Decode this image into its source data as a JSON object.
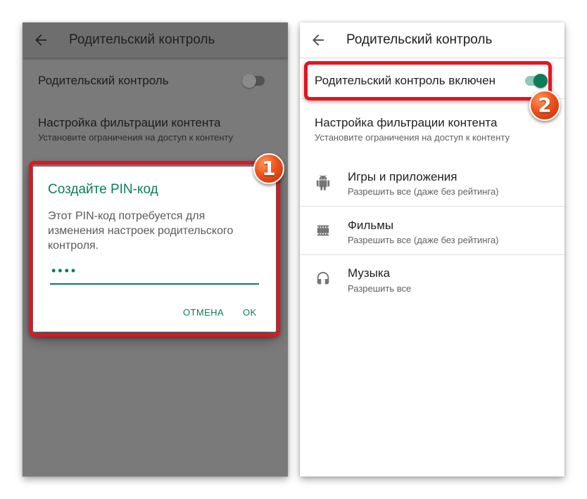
{
  "left_screen": {
    "title": "Родительский контроль",
    "toggle_label": "Родительский контроль",
    "toggle_state": "off",
    "filter_title": "Настройка фильтрации контента",
    "filter_subtitle": "Установите ограничения на доступ к контенту",
    "dialog": {
      "title": "Создайте PIN-код",
      "message": "Этот PIN-код потребуется для изменения настроек родительского контроля.",
      "pin_value": "••••",
      "cancel_label": "ОТМЕНА",
      "ok_label": "OK"
    },
    "callout": "1"
  },
  "right_screen": {
    "title": "Родительский контроль",
    "toggle_label": "Родительский контроль включен",
    "toggle_state": "on",
    "filter_title": "Настройка фильтрации контента",
    "filter_subtitle": "Установите ограничения на доступ к контенту",
    "categories": [
      {
        "icon": "android-icon",
        "title": "Игры и приложения",
        "subtitle": "Разрешить все (даже без рейтинга)"
      },
      {
        "icon": "film-icon",
        "title": "Фильмы",
        "subtitle": "Разрешить все (даже без рейтинга)"
      },
      {
        "icon": "headphones-icon",
        "title": "Музыка",
        "subtitle": "Разрешить все"
      }
    ],
    "callout": "2"
  },
  "colors": {
    "accent": "#0b7d5b",
    "highlight": "#e3141f",
    "callout": "#f0521a",
    "dim_overlay": "#7a7a7a"
  }
}
